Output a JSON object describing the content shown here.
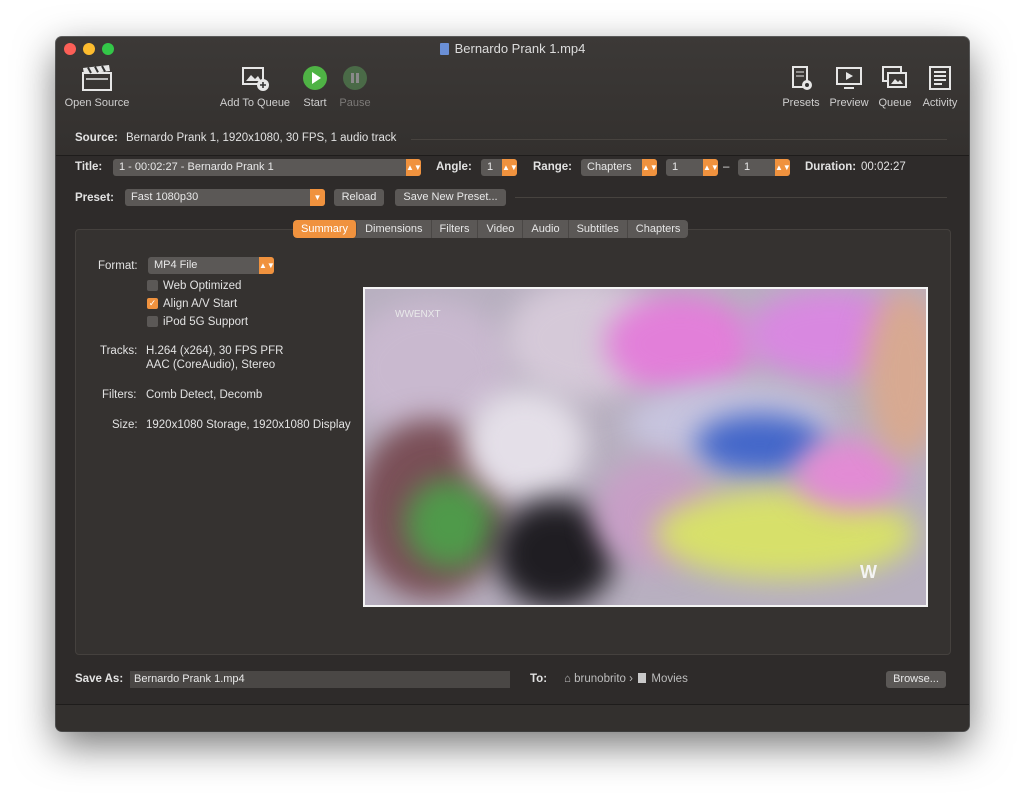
{
  "window": {
    "title": "Bernardo Prank 1.mp4"
  },
  "toolbar": {
    "open_source": "Open Source",
    "add_to_queue": "Add To Queue",
    "start": "Start",
    "pause": "Pause",
    "presets": "Presets",
    "preview": "Preview",
    "queue": "Queue",
    "activity": "Activity"
  },
  "source": {
    "label": "Source:",
    "value": "Bernardo Prank 1, 1920x1080, 30 FPS, 1 audio track"
  },
  "title_row": {
    "title_label": "Title:",
    "title_value": "1 - 00:02:27 - Bernardo Prank 1",
    "angle_label": "Angle:",
    "angle_value": "1",
    "range_label": "Range:",
    "range_type": "Chapters",
    "range_start": "1",
    "range_sep": "–",
    "range_end": "1",
    "duration_label": "Duration:",
    "duration_value": "00:02:27"
  },
  "preset_row": {
    "label": "Preset:",
    "value": "Fast 1080p30",
    "reload": "Reload",
    "save_new": "Save New Preset..."
  },
  "tabs": [
    "Summary",
    "Dimensions",
    "Filters",
    "Video",
    "Audio",
    "Subtitles",
    "Chapters"
  ],
  "summary": {
    "format_label": "Format:",
    "format_value": "MP4 File",
    "web_optimized": "Web Optimized",
    "align_av": "Align A/V Start",
    "ipod": "iPod 5G Support",
    "tracks_label": "Tracks:",
    "tracks_line1": "H.264 (x264), 30 FPS PFR",
    "tracks_line2": "AAC (CoreAudio), Stereo",
    "filters_label": "Filters:",
    "filters_value": "Comb Detect, Decomb",
    "size_label": "Size:",
    "size_value": "1920x1080 Storage, 1920x1080 Display"
  },
  "preview_overlay": {
    "watermark": "WWENXT"
  },
  "save": {
    "label": "Save As:",
    "value": "Bernardo Prank 1.mp4",
    "to_label": "To:",
    "folder_user": "brunobrito",
    "folder_sep": "›",
    "folder_dest": "Movies",
    "browse": "Browse..."
  },
  "colors": {
    "accent": "#f0923e",
    "window_bg": "#2e2b2a",
    "start_green": "#4fb345"
  }
}
